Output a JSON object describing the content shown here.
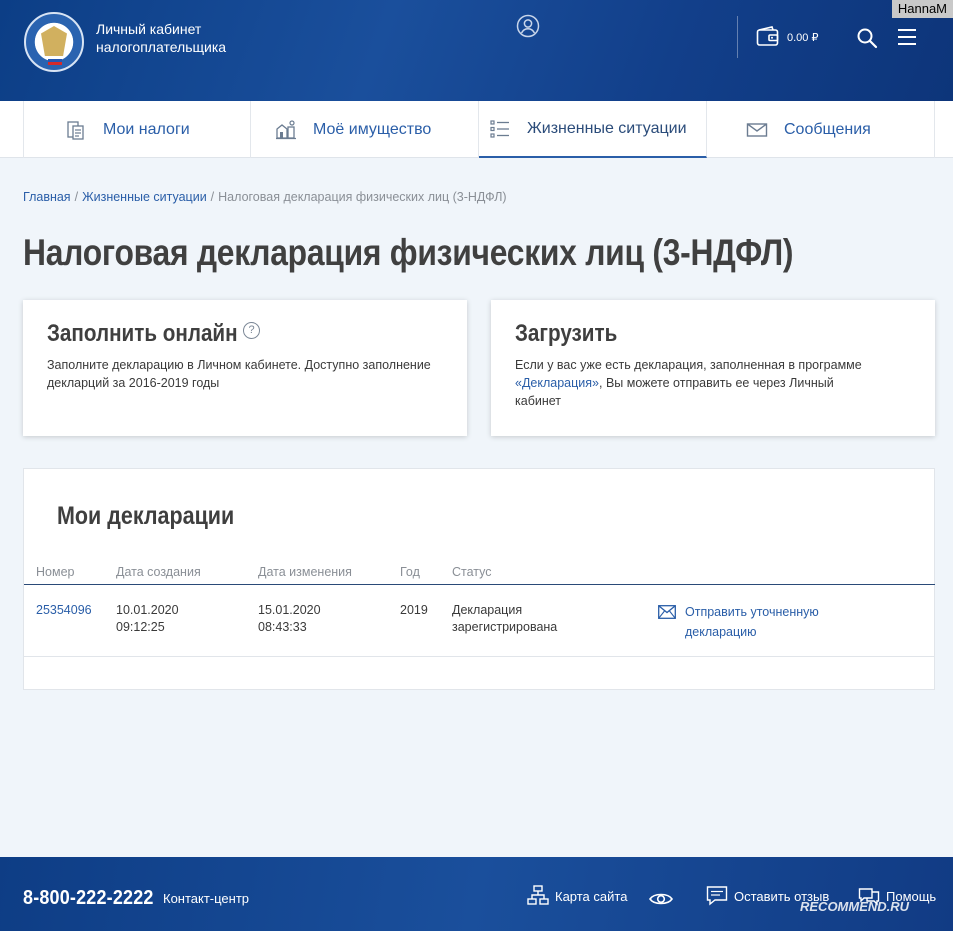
{
  "header": {
    "title_line1": "Личный кабинет",
    "title_line2": "налогоплательщика",
    "balance": "0.00 ₽",
    "watermark_user": "HannaM"
  },
  "tabs": [
    {
      "label": "Мои налоги",
      "icon": "taxes-icon"
    },
    {
      "label": "Моё имущество",
      "icon": "property-icon"
    },
    {
      "label": "Жизненные ситуации",
      "icon": "list-icon",
      "active": true
    },
    {
      "label": "Сообщения",
      "icon": "envelope-icon"
    }
  ],
  "breadcrumb": {
    "home": "Главная",
    "section": "Жизненные ситуации",
    "current": "Налоговая декларация физических лиц (3-НДФЛ)"
  },
  "page_title": "Налоговая декларация физических лиц (3-НДФЛ)",
  "card_online": {
    "title": "Заполнить онлайн",
    "help": "?",
    "text": "Заполните декларацию в Личном кабинете. Доступно заполнение декларций за 2016-2019 годы"
  },
  "card_upload": {
    "title": "Загрузить",
    "text_before": "Если у вас уже есть декларация, заполненная в программе ",
    "link": "«Декларация»",
    "text_after": ", Вы можете отправить ее через Личный кабинет"
  },
  "declarations": {
    "title": "Мои декларации",
    "headers": {
      "number": "Номер",
      "created": "Дата создания",
      "modified": "Дата изменения",
      "year": "Год",
      "status": "Статус"
    },
    "rows": [
      {
        "number": "25354096",
        "created_date": "10.01.2020",
        "created_time": "09:12:25",
        "modified_date": "15.01.2020",
        "modified_time": "08:43:33",
        "year": "2019",
        "status_line1": "Декларация",
        "status_line2": "зарегистрирована",
        "action_line1": "Отправить уточненную",
        "action_line2": "декларацию"
      }
    ]
  },
  "footer": {
    "phone": "8-800-222-2222",
    "contact": "Контакт-центр",
    "sitemap": "Карта сайта",
    "feedback": "Оставить отзыв",
    "help": "Помощь",
    "recommend": "RECOMMEND.RU"
  }
}
